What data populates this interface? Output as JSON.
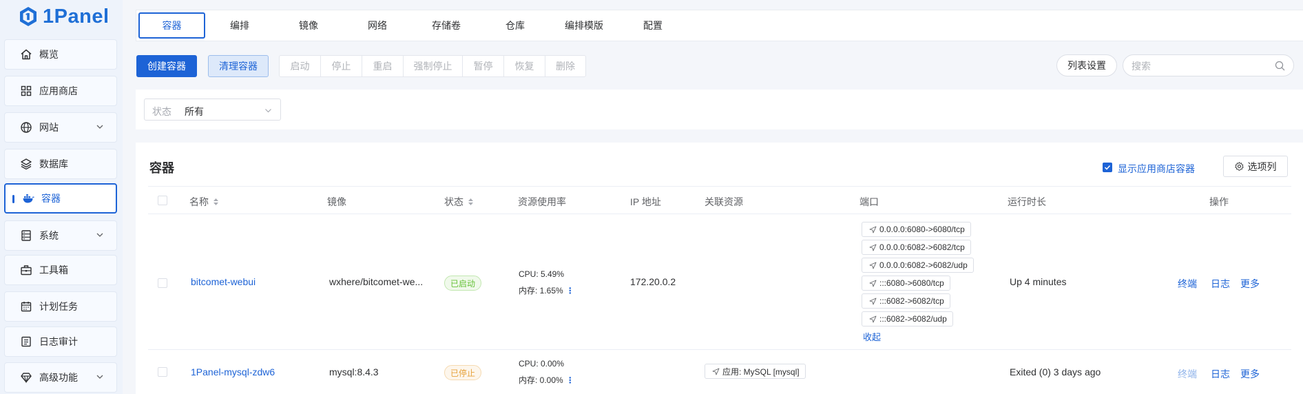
{
  "app": {
    "logo_text": "1Panel"
  },
  "sidebar": {
    "items": [
      {
        "label": "概览",
        "icon": "home-icon"
      },
      {
        "label": "应用商店",
        "icon": "grid-icon"
      },
      {
        "label": "网站",
        "icon": "globe-icon",
        "expandable": true
      },
      {
        "label": "数据库",
        "icon": "layers-icon"
      },
      {
        "label": "容器",
        "icon": "docker-icon",
        "active": true
      },
      {
        "label": "系统",
        "icon": "server-icon",
        "expandable": true
      },
      {
        "label": "工具箱",
        "icon": "toolbox-icon"
      },
      {
        "label": "计划任务",
        "icon": "calendar-icon"
      },
      {
        "label": "日志审计",
        "icon": "log-icon"
      },
      {
        "label": "高级功能",
        "icon": "diamond-icon",
        "expandable": true
      }
    ]
  },
  "tabs": [
    "容器",
    "编排",
    "镜像",
    "网络",
    "存储卷",
    "仓库",
    "编排模版",
    "配置"
  ],
  "toolbar": {
    "create": "创建容器",
    "clean": "清理容器",
    "actions": [
      "启动",
      "停止",
      "重启",
      "强制停止",
      "暂停",
      "恢复",
      "删除"
    ],
    "list_settings": "列表设置",
    "search_placeholder": "搜索"
  },
  "filter": {
    "label": "状态",
    "value": "所有"
  },
  "section": {
    "title": "容器",
    "show_store": "显示应用商店容器",
    "columns_btn": "选项列"
  },
  "table": {
    "headers": {
      "name": "名称",
      "image": "镜像",
      "status": "状态",
      "resource": "资源使用率",
      "ip": "IP 地址",
      "related": "关联资源",
      "port": "端口",
      "uptime": "运行时长",
      "ops": "操作"
    },
    "rows": [
      {
        "name": "bitcomet-webui",
        "image": "wxhere/bitcomet-we...",
        "status": "已启动",
        "cpu": "CPU: 5.49%",
        "mem": "内存: 1.65%",
        "ip": "172.20.0.2",
        "ports": [
          "0.0.0.0:6080->6080/tcp",
          "0.0.0.0:6082->6082/tcp",
          "0.0.0.0:6082->6082/udp",
          ":::6080->6080/tcp",
          ":::6082->6082/tcp",
          ":::6082->6082/udp"
        ],
        "collapse": "收起",
        "uptime": "Up 4 minutes",
        "ops": [
          "终端",
          "日志",
          "更多"
        ]
      },
      {
        "name": "1Panel-mysql-zdw6",
        "image": "mysql:8.4.3",
        "status": "已停止",
        "cpu": "CPU: 0.00%",
        "mem": "内存: 0.00%",
        "related": "应用: MySQL [mysql]",
        "uptime": "Exited (0) 3 days ago",
        "ops": [
          "终端",
          "日志",
          "更多"
        ]
      }
    ]
  },
  "colors": {
    "accent": "#1d63d6",
    "running": "#67c23a",
    "stopped": "#e6a23c"
  }
}
